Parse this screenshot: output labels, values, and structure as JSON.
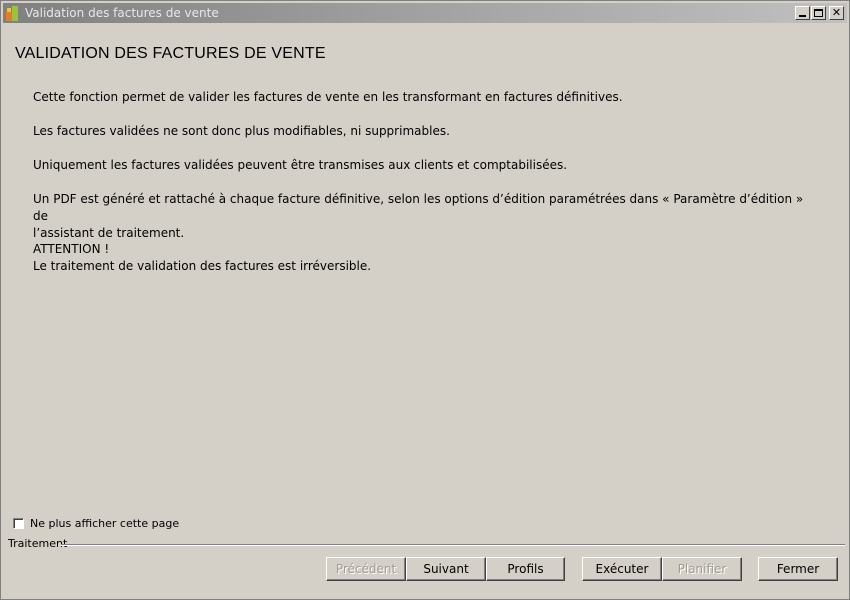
{
  "window": {
    "title": "Validation des factures de vente",
    "controls": {
      "minimize": "_",
      "maximize": "□",
      "close": "✕"
    }
  },
  "page": {
    "heading": "VALIDATION DES FACTURES DE VENTE",
    "paragraphs": [
      "Cette fonction permet de valider les factures de vente en les transformant en factures définitives.",
      "Les factures validées ne sont donc plus modifiables, ni supprimables.",
      "Uniquement les factures validées peuvent être transmises aux clients et comptabilisées.",
      "Un PDF est généré et rattaché à chaque facture définitive, selon les options d’édition paramétrées dans « Paramètre d’édition » de\nl’assistant de traitement.",
      "ATTENTION !\nLe traitement de validation des factures est irréversible."
    ]
  },
  "footer": {
    "checkbox_label": "Ne plus afficher cette page",
    "checkbox_checked": false,
    "group_label": "Traitement",
    "buttons": {
      "precedent": "Précédent",
      "suivant": "Suivant",
      "profils": "Profils",
      "executer": "Exécuter",
      "planifier": "Planifier",
      "fermer": "Fermer"
    }
  },
  "colors": {
    "window_bg": "#d4d0c8",
    "titlebar_inactive": "#808080"
  }
}
